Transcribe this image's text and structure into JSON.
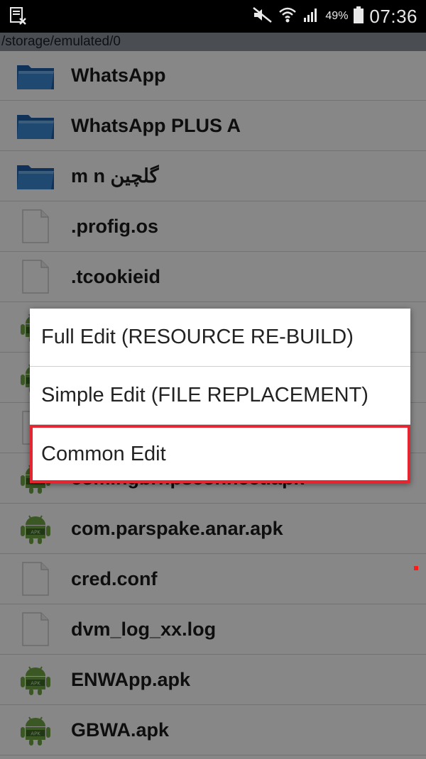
{
  "status_bar": {
    "battery_percent": "49%",
    "time": "07:36",
    "icons": [
      "screenshot-x-icon",
      "mute-icon",
      "wifi-icon",
      "signal-icon",
      "battery-icon"
    ]
  },
  "path": "/storage/emulated/0",
  "files": [
    {
      "name": "WhatsApp",
      "icon": "folder-icon"
    },
    {
      "name": "WhatsApp PLUS A",
      "icon": "folder-icon"
    },
    {
      "name": "m n گلچین",
      "icon": "folder-icon"
    },
    {
      "name": ".profig.os",
      "icon": "file-icon"
    },
    {
      "name": ".tcookieid",
      "icon": "file-icon"
    },
    {
      "name": "",
      "icon": "apk-icon"
    },
    {
      "name": "",
      "icon": "apk-icon"
    },
    {
      "name": "",
      "icon": "file-icon"
    },
    {
      "name": "com.ngbrr.psconnect.apk",
      "icon": "apk-icon"
    },
    {
      "name": "com.parspake.anar.apk",
      "icon": "apk-icon"
    },
    {
      "name": "cred.conf",
      "icon": "file-icon"
    },
    {
      "name": "dvm_log_xx.log",
      "icon": "file-icon"
    },
    {
      "name": "ENWApp.apk",
      "icon": "apk-icon"
    },
    {
      "name": "GBWA.apk",
      "icon": "apk-icon"
    }
  ],
  "menu": {
    "items": [
      {
        "label": "Full Edit (RESOURCE RE-BUILD)",
        "highlighted": false
      },
      {
        "label": "Simple Edit (FILE REPLACEMENT)",
        "highlighted": false
      },
      {
        "label": "Common Edit",
        "highlighted": true
      }
    ]
  },
  "colors": {
    "highlight_border": "#e52631",
    "apk_green": "#6ea544",
    "folder_blue": "#2c6fb8"
  }
}
